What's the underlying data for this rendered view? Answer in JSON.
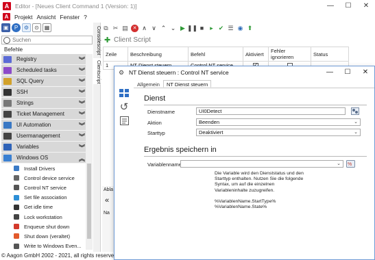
{
  "window": {
    "title": "Editor - [Neues Client Command 1 (Version: 1)]",
    "minimize_glyph": "—",
    "maximize_glyph": "☐",
    "close_glyph": "✕"
  },
  "menu": [
    "Projekt",
    "Ansicht",
    "Fenster",
    "?"
  ],
  "search": {
    "placeholder": "Suchen",
    "value": ""
  },
  "commands_header": "Befehle",
  "categories": [
    {
      "label": "Registry",
      "icon": "registry-icon",
      "color": "#5b6bd6"
    },
    {
      "label": "Scheduled tasks",
      "icon": "scheduled-tasks-icon",
      "color": "#8c4ac9"
    },
    {
      "label": "SQL Query",
      "icon": "sql-icon",
      "color": "#d2a12a"
    },
    {
      "label": "SSH",
      "icon": "ssh-icon",
      "color": "#333333"
    },
    {
      "label": "Strings",
      "icon": "strings-icon",
      "color": "#777777"
    },
    {
      "label": "Ticket Management",
      "icon": "ticket-icon",
      "color": "#444444"
    },
    {
      "label": "UI Automation",
      "icon": "ui-automation-icon",
      "color": "#3a78c4"
    },
    {
      "label": "Usermanagement",
      "icon": "usermanagement-icon",
      "color": "#444444"
    },
    {
      "label": "Variables",
      "icon": "variables-icon",
      "color": "#2f63b8"
    },
    {
      "label": "Windows OS",
      "icon": "windows-icon",
      "color": "#3a80d2"
    }
  ],
  "windows_commands": [
    {
      "label": "Install Drivers",
      "icon": "driver-icon",
      "color": "#3a7ac6"
    },
    {
      "label": "Control device service",
      "icon": "device-service-icon",
      "color": "#666666"
    },
    {
      "label": "Control NT service",
      "icon": "nt-service-icon",
      "color": "#555555"
    },
    {
      "label": "Set file association",
      "icon": "file-association-icon",
      "color": "#2d8fd6"
    },
    {
      "label": "Get idle time",
      "icon": "idle-time-icon",
      "color": "#333333"
    },
    {
      "label": "Lock workstation",
      "icon": "lock-icon",
      "color": "#444444"
    },
    {
      "label": "Enqueue shut down",
      "icon": "enqueue-shutdown-icon",
      "color": "#d33a2c"
    },
    {
      "label": "Shut down (veraltet)",
      "icon": "shutdown-icon",
      "color": "#e25a2c"
    },
    {
      "label": "Write to Windows Even...",
      "icon": "event-log-icon",
      "color": "#555555"
    }
  ],
  "status": "© Aagon GmbH 2002 - 2021, all rights reserved",
  "vertical_tabs": {
    "console": "Consolescript",
    "client": "Clientscript"
  },
  "script_title": "Client Script",
  "table": {
    "headers": [
      "Zeile",
      "Beschreibung",
      "Befehl",
      "Aktiviert",
      "Fehler ignorieren",
      "Status"
    ],
    "rows": [
      {
        "line": "1",
        "description": "NT Dienst steuern",
        "command": "Control NT service",
        "active": true,
        "ignore_errors": false,
        "status": ""
      }
    ]
  },
  "background_fragments": {
    "label_a": "Abla",
    "label_b": "Na",
    "arrow": "«"
  },
  "dialog": {
    "title": "NT Dienst steuern : Control NT service",
    "tabs": [
      "Allgemein",
      "NT Dienst steuern"
    ],
    "section_service": "Dienst",
    "service_name_label": "Dienstname",
    "service_name_value": "UI0Detect",
    "action_label": "Aktion",
    "action_value": "Beenden",
    "starttype_label": "Starttyp",
    "starttype_value": "Deaktiviert",
    "section_result": "Ergebnis speichern in",
    "variable_label": "Variablenname",
    "variable_value": "",
    "note_lines": [
      "Die Variable wird den Dienststatus und den",
      "Starttyp enthalten. Nutzen Sie die folgende",
      "Syntax, um auf die einzelnen",
      "Variableninhalte zuzugreifen.",
      "",
      "%VariablenName.StartType%",
      "%VariablenName.State%"
    ]
  }
}
